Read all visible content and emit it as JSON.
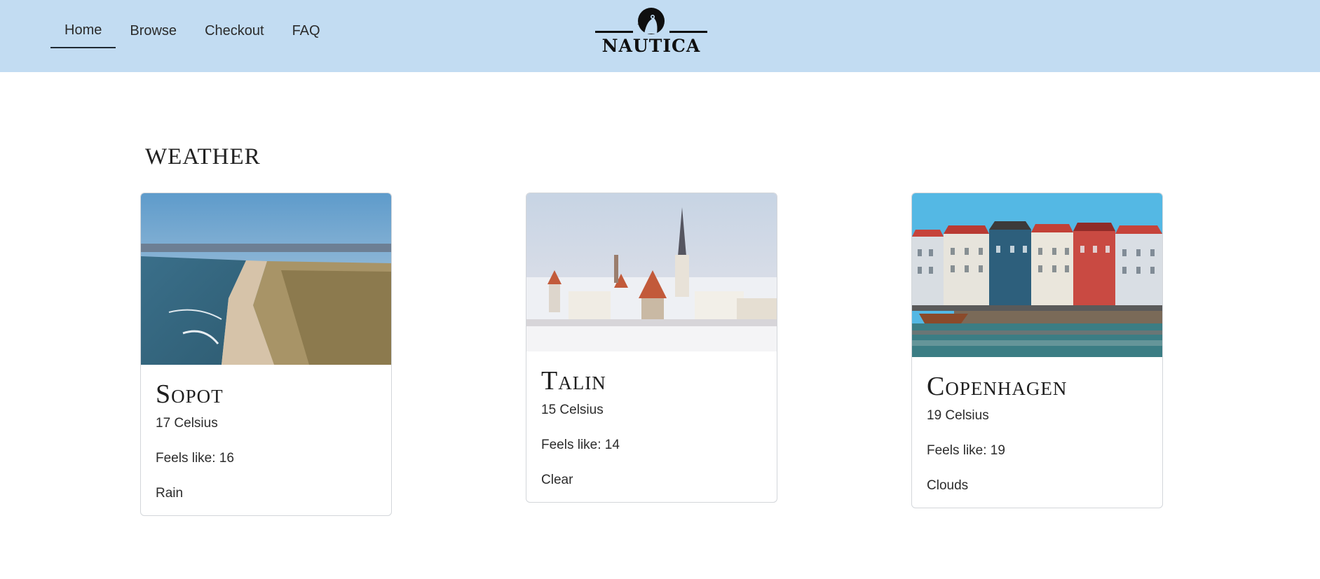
{
  "nav": {
    "items": [
      {
        "label": "Home",
        "active": true
      },
      {
        "label": "Browse"
      },
      {
        "label": "Checkout"
      },
      {
        "label": "FAQ"
      }
    ],
    "logo_text": "NAUTICA"
  },
  "main": {
    "section_title": "WEATHER",
    "cards": [
      {
        "city": "Sopot",
        "temperature": "17 Celsius",
        "feels_like": "Feels like: 16",
        "condition": "Rain"
      },
      {
        "city": "Talin",
        "temperature": "15 Celsius",
        "feels_like": "Feels like: 14",
        "condition": "Clear"
      },
      {
        "city": "Copenhagen",
        "temperature": "19 Celsius",
        "feels_like": "Feels like: 19",
        "condition": "Clouds"
      }
    ]
  },
  "colors": {
    "navbar_bg": "#c2dcf2",
    "text": "#212529",
    "card_border": "#d3d6da"
  }
}
